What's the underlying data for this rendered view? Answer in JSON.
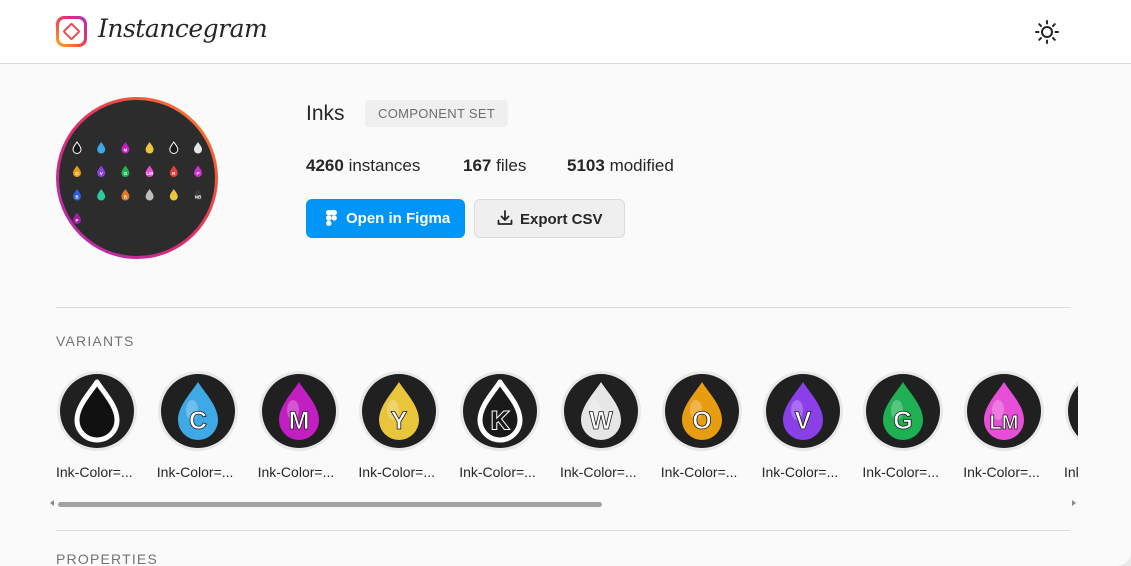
{
  "header": {
    "brand_name": "Instancegram",
    "logo_icon": "diamond-logo-icon",
    "theme_toggle_icon": "sun-icon"
  },
  "component": {
    "title": "Inks",
    "badge": "COMPONENT SET",
    "stats": [
      {
        "value": "4260",
        "label": "instances"
      },
      {
        "value": "167",
        "label": "files"
      },
      {
        "value": "5103",
        "label": "modified"
      }
    ],
    "open_button": "Open in Figma",
    "open_icon": "figma-icon",
    "export_button": "Export CSV",
    "export_icon": "download-icon",
    "preview_glyphs": [
      "",
      "",
      "M",
      "",
      "",
      "",
      "O",
      "V",
      "G",
      "LM",
      "R",
      "P",
      "B",
      "",
      "B",
      "",
      "",
      "NB",
      "P"
    ]
  },
  "variants": {
    "heading": "VARIANTS",
    "items": [
      {
        "letter": "",
        "color": "#111111",
        "outline": true,
        "label": "Ink-Color=..."
      },
      {
        "letter": "C",
        "color": "#3fa9e6",
        "label": "Ink-Color=..."
      },
      {
        "letter": "M",
        "color": "#c21ec2",
        "label": "Ink-Color=..."
      },
      {
        "letter": "Y",
        "color": "#e8c53b",
        "label": "Ink-Color=..."
      },
      {
        "letter": "K",
        "color": "#1a1a1a",
        "outline": true,
        "label": "Ink-Color=..."
      },
      {
        "letter": "W",
        "color": "#e6e6e6",
        "label": "Ink-Color=..."
      },
      {
        "letter": "O",
        "color": "#e89c10",
        "label": "Ink-Color=..."
      },
      {
        "letter": "V",
        "color": "#8a3fe8",
        "label": "Ink-Color=..."
      },
      {
        "letter": "G",
        "color": "#1fb054",
        "label": "Ink-Color=..."
      },
      {
        "letter": "LM",
        "color": "#e84fd8",
        "label": "Ink-Color=..."
      },
      {
        "letter": "",
        "color": "#111111",
        "label": "Ink-Color=..."
      }
    ]
  },
  "properties": {
    "heading": "PROPERTIES"
  }
}
